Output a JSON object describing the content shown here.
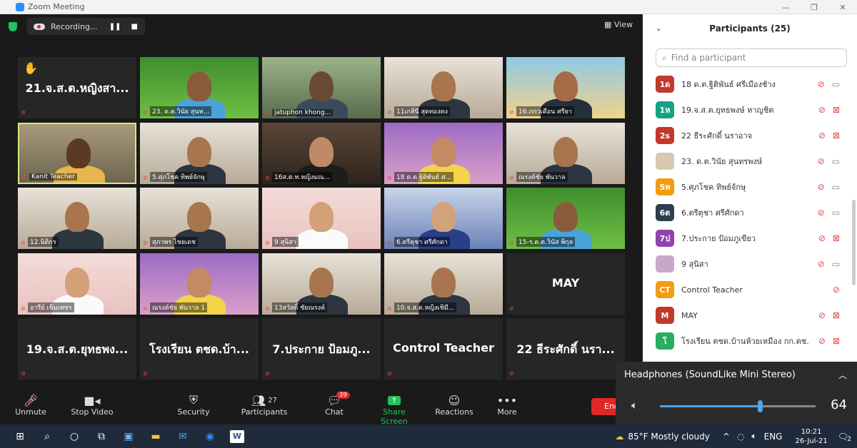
{
  "window": {
    "title": "Zoom Meeting"
  },
  "topbar": {
    "recording_label": "Recording...",
    "view_label": "View"
  },
  "tiles": [
    {
      "name": "21.จ.ส.ต.หญิงสา...",
      "type": "name",
      "hand": true
    },
    {
      "name": "23. ด.ต.วินัย สุนท...",
      "type": "video",
      "scene": "field"
    },
    {
      "name": "jatuphon khong...",
      "type": "video",
      "scene": "outdoor"
    },
    {
      "name": "11เกสินี สุดทองคง",
      "type": "video",
      "scene": "room"
    },
    {
      "name": "16.ภกวเดือน ศรียา",
      "type": "video",
      "scene": "beach"
    },
    {
      "name": "Kanit Teacher",
      "type": "video",
      "scene": "blur",
      "active": true
    },
    {
      "name": "5.ศุภโชค ทิพย์จักษุ",
      "type": "video",
      "scene": "room"
    },
    {
      "name": "16ส.ต.ท.หญิงมณ...",
      "type": "video",
      "scene": "dark"
    },
    {
      "name": "18 ด.ต.ฐิติพันธ์ ศ...",
      "type": "video",
      "scene": "purple"
    },
    {
      "name": "ณรงค์ชัย พันวาล",
      "type": "video",
      "scene": "room"
    },
    {
      "name": "12.นิติกร",
      "type": "video",
      "scene": "room"
    },
    {
      "name": "สุภาพร ไชยเดช",
      "type": "video",
      "scene": "room"
    },
    {
      "name": "9 สุนิสา",
      "type": "video",
      "scene": "pink"
    },
    {
      "name": "6.ตรีตุชา ศรีศักดา",
      "type": "video",
      "scene": "blue"
    },
    {
      "name": "15-ร.ต.ต.วินัส พิกุล",
      "type": "video",
      "scene": "field"
    },
    {
      "name": "อารีย์ เข็มเพชร",
      "type": "video",
      "scene": "pink"
    },
    {
      "name": "ณรงค์ชัย พันวาล 1",
      "type": "video",
      "scene": "purple"
    },
    {
      "name": "13สวัสดิ์ ชัยณรงค์",
      "type": "video",
      "scene": "room"
    },
    {
      "name": "10.จ.ส.ต.หญิงเชิมี...",
      "type": "video",
      "scene": "room"
    },
    {
      "name": "MAY",
      "type": "name"
    },
    {
      "name": "19.จ.ส.ต.ยุทธพง...",
      "type": "name"
    },
    {
      "name": "โรงเรียน ตชด.บ้า...",
      "type": "name"
    },
    {
      "name": "7.ประกาย ป้อมภู...",
      "type": "name"
    },
    {
      "name": "Control Teacher",
      "type": "name"
    },
    {
      "name": "22 ธีระศักดิ์ นรา...",
      "type": "name"
    }
  ],
  "toolbar": {
    "unmute": "Unmute",
    "stop_video": "Stop Video",
    "security": "Security",
    "participants": "Participants",
    "participants_count": "27",
    "chat": "Chat",
    "chat_badge": "39",
    "share_screen": "Share Screen",
    "reactions": "Reactions",
    "more": "More",
    "end": "End"
  },
  "panel": {
    "title": "Participants (25)",
    "search_placeholder": "Find a participant",
    "participants": [
      {
        "initials": "1ด",
        "color": "#c0392b",
        "name": "18 ด.ต.ฐิติพันธ์ ศรีเมืองช้าง",
        "cam_off": false
      },
      {
        "initials": "1ห",
        "color": "#16a085",
        "name": "19.จ.ส.ต.ยุทธพงษ์ หาญชิต",
        "cam_off": true
      },
      {
        "initials": "2s",
        "color": "#c0392b",
        "name": "22 ธีระศักดิ์ นราอาจ",
        "cam_off": true
      },
      {
        "initials": "",
        "color": "#d8c8b0",
        "name": "23. ด.ต.วินัย สุนทรพงษ์",
        "cam_off": false
      },
      {
        "initials": "5ท",
        "color": "#f39c12",
        "name": "5.ศุภโชค ทิพย์จักษุ",
        "cam_off": false
      },
      {
        "initials": "6ต",
        "color": "#2c3e50",
        "name": "6.ตรีตุชา ศรีศักดา",
        "cam_off": false
      },
      {
        "initials": "7ป",
        "color": "#8e44ad",
        "name": "7.ประกาย ป้อมภูเขียว",
        "cam_off": true
      },
      {
        "initials": "",
        "color": "#c8a8c8",
        "name": "9 สุนิสา",
        "cam_off": false
      },
      {
        "initials": "CT",
        "color": "#f39c12",
        "name": "Control Teacher",
        "cam_off": null
      },
      {
        "initials": "M",
        "color": "#c0392b",
        "name": "MAY",
        "cam_off": true
      },
      {
        "initials": "โ",
        "color": "#27ae60",
        "name": "โรงเรียน ตชด.บ้านห้วยเหมือง กก.ตช...",
        "cam_off": true
      }
    ]
  },
  "volume": {
    "device": "Headphones (SoundLike Mini Stereo)",
    "level": 64
  },
  "taskbar": {
    "weather": "85°F Mostly cloudy",
    "lang": "ENG",
    "time": "10:21",
    "date": "26-Jul-21",
    "notif": "2"
  }
}
